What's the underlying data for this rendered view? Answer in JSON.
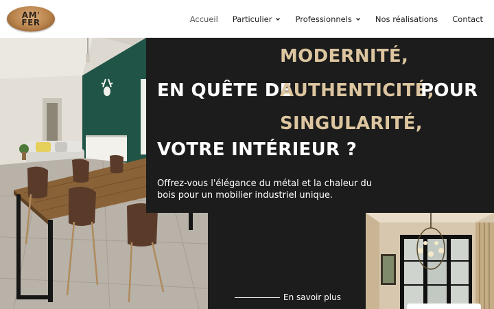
{
  "brand": {
    "logo_line1": "AM'",
    "logo_line2": "FER"
  },
  "nav": {
    "items": [
      {
        "label": "Accueil",
        "active": true,
        "has_dropdown": false
      },
      {
        "label": "Particulier",
        "active": false,
        "has_dropdown": true
      },
      {
        "label": "Professionnels",
        "active": false,
        "has_dropdown": true
      },
      {
        "label": "Nos réalisations",
        "active": false,
        "has_dropdown": false
      },
      {
        "label": "Contact",
        "active": false,
        "has_dropdown": false
      }
    ]
  },
  "hero": {
    "line_prefix": "EN QUÊTE DE",
    "rotating_words": [
      "MODERNITÉ,",
      "AUTHENTICITÉ,",
      "SINGULARITÉ,"
    ],
    "line_suffix": "POUR",
    "line_2": "VOTRE INTÉRIEUR ?",
    "paragraph": "Offrez-vous l'élégance du métal et la chaleur du bois pour un mobilier industriel unique.",
    "cta_label": "En savoir plus"
  },
  "colors": {
    "accent_gold": "#dcc59f",
    "dark_background": "#1c1c1c",
    "text_light": "#ffffff",
    "nav_text": "#1e1e1e"
  }
}
